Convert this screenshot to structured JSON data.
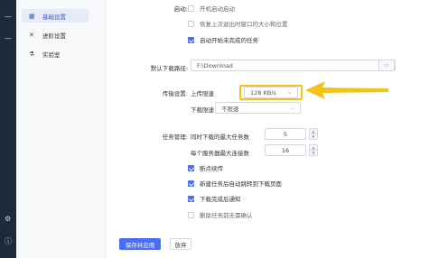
{
  "sidebar": {
    "items": [
      {
        "label": "基础设置",
        "icon": "grid-icon",
        "active": true
      },
      {
        "label": "进阶设置",
        "icon": "tools-icon",
        "active": false
      },
      {
        "label": "实验室",
        "icon": "flask-icon",
        "active": false
      }
    ]
  },
  "general": {
    "startup_label": "启动:",
    "options": [
      {
        "label": "开机启动启动",
        "checked": false
      },
      {
        "label": "恢复上次退出时窗口的大小和位置",
        "checked": false
      },
      {
        "label": "自动开始未完成的任务",
        "checked": true
      }
    ]
  },
  "download_path": {
    "label": "默认下载路径:",
    "value": "F:\\Download"
  },
  "transfer": {
    "label": "传输设置:",
    "upload_label": "上传限速",
    "upload_value": "128 KB/s",
    "download_label": "下载限速",
    "download_value": "不限速"
  },
  "tasks": {
    "label": "任务管理:",
    "max_tasks_label": "同时下载的最大任务数",
    "max_tasks_value": "5",
    "max_conn_label": "每个服务器最大连接数",
    "max_conn_value": "16",
    "options": [
      {
        "label": "断点续传",
        "checked": true
      },
      {
        "label": "新建任务后自动跳转到下载页面",
        "checked": true
      },
      {
        "label": "下载完成后通知",
        "checked": true
      },
      {
        "label": "删除任务前无需确认",
        "checked": false
      }
    ]
  },
  "actions": {
    "save_label": "保存并应用",
    "discard_label": "放弃"
  },
  "colors": {
    "accent": "#4a6cf7",
    "highlight": "#f5c218",
    "rail": "#1e2a3a"
  }
}
